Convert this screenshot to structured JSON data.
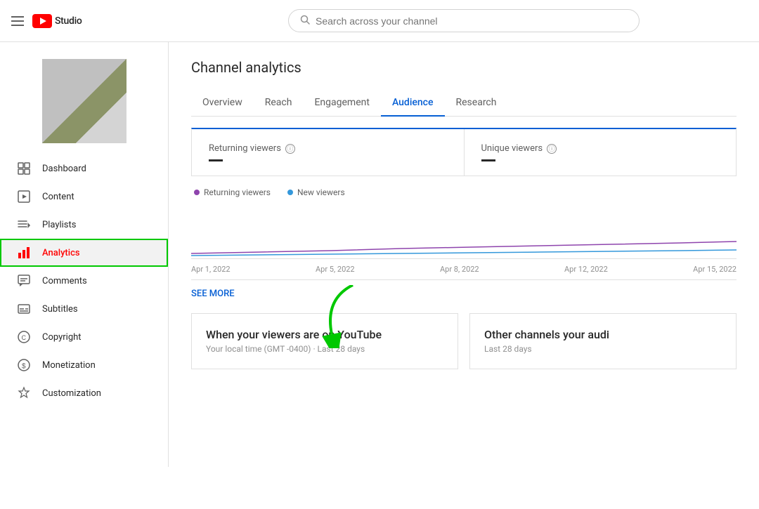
{
  "header": {
    "menu_icon": "☰",
    "logo_text": "Studio",
    "search_placeholder": "Search across your channel"
  },
  "sidebar": {
    "nav_items": [
      {
        "id": "dashboard",
        "label": "Dashboard",
        "icon": "dashboard"
      },
      {
        "id": "content",
        "label": "Content",
        "icon": "content"
      },
      {
        "id": "playlists",
        "label": "Playlists",
        "icon": "playlists"
      },
      {
        "id": "analytics",
        "label": "Analytics",
        "icon": "analytics",
        "active": true
      },
      {
        "id": "comments",
        "label": "Comments",
        "icon": "comments"
      },
      {
        "id": "subtitles",
        "label": "Subtitles",
        "icon": "subtitles"
      },
      {
        "id": "copyright",
        "label": "Copyright",
        "icon": "copyright"
      },
      {
        "id": "monetization",
        "label": "Monetization",
        "icon": "monetization"
      },
      {
        "id": "customization",
        "label": "Customization",
        "icon": "customization"
      }
    ]
  },
  "main": {
    "page_title": "Channel analytics",
    "tabs": [
      {
        "id": "overview",
        "label": "Overview"
      },
      {
        "id": "reach",
        "label": "Reach"
      },
      {
        "id": "engagement",
        "label": "Engagement"
      },
      {
        "id": "audience",
        "label": "Audience",
        "active": true
      },
      {
        "id": "research",
        "label": "Research"
      }
    ],
    "metrics": [
      {
        "id": "returning",
        "label": "Returning viewers",
        "value": "—"
      },
      {
        "id": "unique",
        "label": "Unique viewers",
        "value": "—"
      }
    ],
    "legend": [
      {
        "id": "returning",
        "label": "Returning viewers",
        "color": "purple"
      },
      {
        "id": "new",
        "label": "New viewers",
        "color": "blue"
      }
    ],
    "date_labels": [
      "Apr 1, 2022",
      "Apr 5, 2022",
      "Apr 8, 2022",
      "Apr 12, 2022",
      "Apr 15, 2022"
    ],
    "see_more": "SEE MORE",
    "bottom_cards": [
      {
        "id": "viewers-when",
        "title": "When your viewers are on YouTube",
        "subtitle": "Your local time (GMT -0400) · Last 28 days"
      },
      {
        "id": "other-channels",
        "title": "Other channels your audi",
        "subtitle": "Last 28 days"
      }
    ]
  }
}
